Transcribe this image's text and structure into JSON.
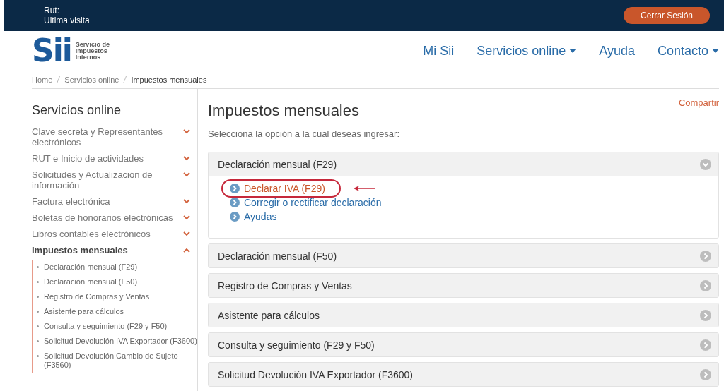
{
  "top_bar": {
    "user_lines": [
      "Rut:",
      "Ultima visita"
    ],
    "logout_button": "Cerrar Sesión"
  },
  "header": {
    "logo": {
      "mark": "Sii",
      "text_lines": [
        "Servicio de",
        "Impuestos",
        "Internos"
      ]
    },
    "nav": [
      {
        "label": "Mi Sii",
        "dropdown": false
      },
      {
        "label": "Servicios online",
        "dropdown": true
      },
      {
        "label": "Ayuda",
        "dropdown": false
      },
      {
        "label": "Contacto",
        "dropdown": true
      }
    ]
  },
  "breadcrumb": [
    {
      "label": "Home",
      "current": false
    },
    {
      "label": "Servicios online",
      "current": false
    },
    {
      "label": "Impuestos mensuales",
      "current": true
    }
  ],
  "sidebar": {
    "title": "Servicios online",
    "items": [
      {
        "label": "Clave secreta y Representantes electrónicos",
        "expanded": false
      },
      {
        "label": "RUT e Inicio de actividades",
        "expanded": false
      },
      {
        "label": "Solicitudes y Actualización de información",
        "expanded": false
      },
      {
        "label": "Factura electrónica",
        "expanded": false
      },
      {
        "label": "Boletas de honorarios electrónicas",
        "expanded": false
      },
      {
        "label": "Libros contables electrónicos",
        "expanded": false
      },
      {
        "label": "Impuestos mensuales",
        "expanded": true,
        "children": [
          {
            "label": "Declaración mensual (F29)"
          },
          {
            "label": "Declaración mensual (F50)"
          },
          {
            "label": "Registro de Compras y Ventas"
          },
          {
            "label": "Asistente para cálculos"
          },
          {
            "label": "Consulta y seguimiento (F29 y F50)"
          },
          {
            "label": "Solicitud Devolución IVA Exportador (F3600)"
          },
          {
            "label": "Solicitud Devolución Cambio de Sujeto (F3560)"
          }
        ]
      }
    ]
  },
  "main": {
    "share_link": "Compartir",
    "title": "Impuestos mensuales",
    "subtitle": "Selecciona la opción a la cual deseas ingresar:",
    "sections": [
      {
        "title": "Declaración mensual (F29)",
        "expanded": true,
        "links": [
          {
            "label": "Declarar IVA (F29)",
            "annotated": true
          },
          {
            "label": "Corregir o rectificar declaración",
            "annotated": false
          },
          {
            "label": "Ayudas",
            "annotated": false
          }
        ]
      },
      {
        "title": "Declaración mensual (F50)",
        "expanded": false
      },
      {
        "title": "Registro de Compras y Ventas",
        "expanded": false
      },
      {
        "title": "Asistente para cálculos",
        "expanded": false
      },
      {
        "title": "Consulta y seguimiento (F29 y F50)",
        "expanded": false
      },
      {
        "title": "Solicitud Devolución IVA Exportador (F3600)",
        "expanded": false
      }
    ]
  }
}
